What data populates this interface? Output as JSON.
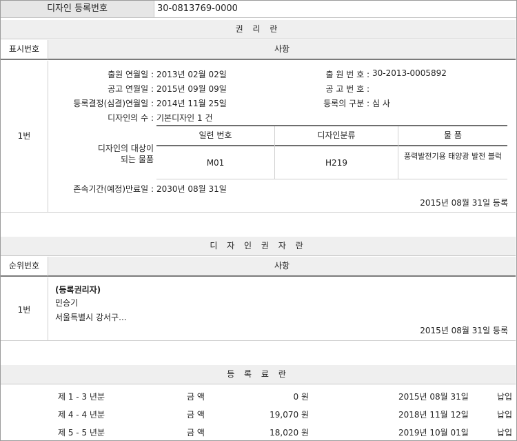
{
  "header": {
    "label": "디자인 등록번호",
    "value": "30-0813769-0000"
  },
  "rights_section": {
    "title": "권 리 란",
    "col_index": "표시번호",
    "col_matter": "사항",
    "entry_no": "1번",
    "filing_date_label": "출원 연월일 :",
    "filing_date": "2013년 02월 02일",
    "filing_no_label": "출 원 번 호 :",
    "filing_no": "30-2013-0005892",
    "pub_date_label": "공고 연월일 :",
    "pub_date": "2015년 09월 09일",
    "pub_no_label": "공 고 번 호 :",
    "pub_no": "",
    "decision_date_label": "등록결정(심결)연월일 :",
    "decision_date": "2014년 11월 25일",
    "reg_type_label": "등록의 구분 :",
    "reg_type": "심 사",
    "design_count_label": "디자인의 수 :",
    "design_count": "기본디자인 1 건",
    "target_label_line1": "디자인의 대상이",
    "target_label_line2": "되는 물품",
    "table_headers": [
      "일련 번호",
      "디자인분류",
      "물 품"
    ],
    "table_row": [
      "M01",
      "H219",
      "풍력발전기용 태양광 발전 블럭"
    ],
    "expiry_label": "존속기간(예정)만료일 :",
    "expiry_date": "2030년 08월 31일",
    "registered_note": "2015년 08월 31일 등록"
  },
  "owner_section": {
    "title": "디 자 인 권 자 란",
    "col_index": "순위번호",
    "col_matter": "사항",
    "entry_no": "1번",
    "role": "(등록권리자)",
    "name": "민승기",
    "address": "서울특별시 강서구...",
    "registered_note": "2015년 08월 31일 등록"
  },
  "fee_section": {
    "title": "등 록 료 란",
    "rows": [
      {
        "period": "제 1 - 3 년분",
        "amount_label": "금 액",
        "amount": "0 원",
        "date": "2015년 08월 31일",
        "status": "납입"
      },
      {
        "period": "제 4 - 4 년분",
        "amount_label": "금 액",
        "amount": "19,070 원",
        "date": "2018년 11월 12일",
        "status": "납입"
      },
      {
        "period": "제 5 - 5 년분",
        "amount_label": "금 액",
        "amount": "18,020 원",
        "date": "2019년 10월 01일",
        "status": "납입"
      }
    ]
  }
}
